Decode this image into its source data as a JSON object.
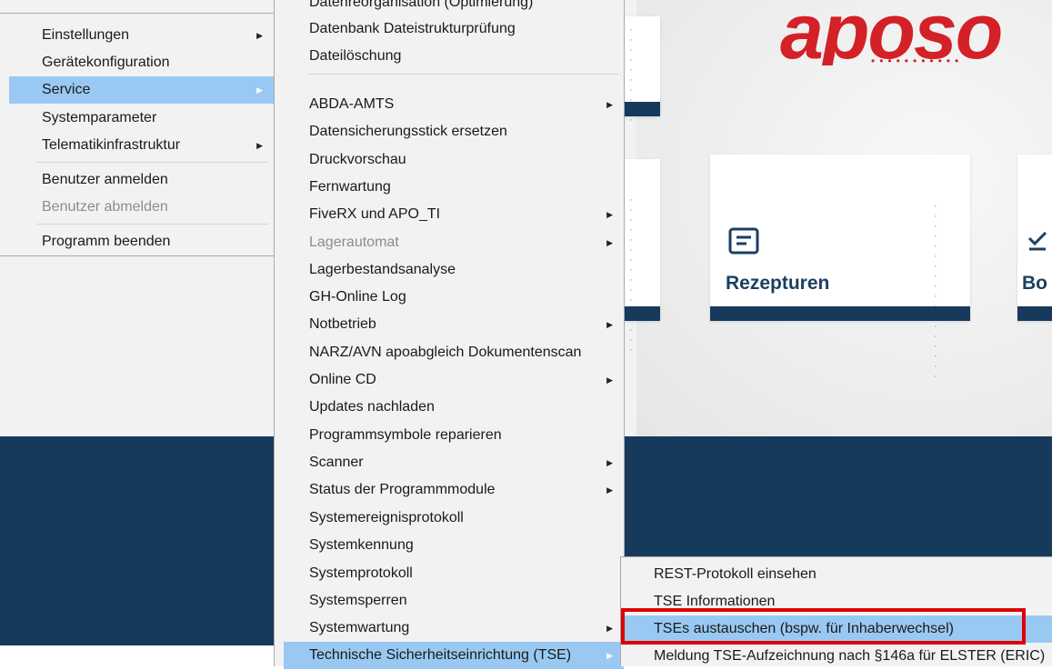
{
  "logo": {
    "text": "aposo",
    "color": "#d42027"
  },
  "tiles": {
    "rezepturen_label": "Rezepturen",
    "rezepturen_icon": "document-icon",
    "partial_right_label": "Bo",
    "partial_right_icon": "checklist-icon"
  },
  "colors": {
    "highlight": "#99c9f2",
    "navy": "#163a5c",
    "annotation": "#e00000"
  },
  "main_menu": {
    "items": [
      {
        "label": "Einstellungen",
        "submenu": true
      },
      {
        "label": "Gerätekonfiguration"
      },
      {
        "label": "Service",
        "submenu": true,
        "highlighted": true
      },
      {
        "label": "Systemparameter"
      },
      {
        "label": "Telematikinfrastruktur",
        "submenu": true
      },
      {
        "label": "Benutzer anmelden"
      },
      {
        "label": "Benutzer abmelden",
        "disabled": true
      },
      {
        "label": "Programm beenden"
      }
    ]
  },
  "service_menu": {
    "items": [
      {
        "label": "Datenreorganisation (Optimierung)"
      },
      {
        "label": "Datenbank Dateistrukturprüfung"
      },
      {
        "label": "Dateilöschung"
      },
      {
        "label": "ABDA-AMTS",
        "submenu": true
      },
      {
        "label": "Datensicherungsstick ersetzen"
      },
      {
        "label": "Druckvorschau"
      },
      {
        "label": "Fernwartung"
      },
      {
        "label": "FiveRX und APO_TI",
        "submenu": true
      },
      {
        "label": "Lagerautomat",
        "submenu": true,
        "disabled": true
      },
      {
        "label": "Lagerbestandsanalyse"
      },
      {
        "label": "GH-Online Log"
      },
      {
        "label": "Notbetrieb",
        "submenu": true
      },
      {
        "label": "NARZ/AVN apoabgleich Dokumentenscan"
      },
      {
        "label": "Online CD",
        "submenu": true
      },
      {
        "label": "Updates nachladen"
      },
      {
        "label": "Programmsymbole reparieren"
      },
      {
        "label": "Scanner",
        "submenu": true
      },
      {
        "label": "Status der Programmmodule",
        "submenu": true
      },
      {
        "label": "Systemereignisprotokoll"
      },
      {
        "label": "Systemkennung"
      },
      {
        "label": "Systemprotokoll"
      },
      {
        "label": "Systemsperren"
      },
      {
        "label": "Systemwartung",
        "submenu": true
      },
      {
        "label": "Technische Sicherheitseinrichtung (TSE)",
        "submenu": true,
        "highlighted": true
      }
    ]
  },
  "tse_menu": {
    "items": [
      {
        "label": "REST-Protokoll einsehen"
      },
      {
        "label": "TSE Informationen"
      },
      {
        "label": "TSEs austauschen (bspw. für Inhaberwechsel)",
        "highlighted": true,
        "annotated": true
      },
      {
        "label": "Meldung TSE-Aufzeichnung nach §146a für ELSTER (ERIC)"
      }
    ]
  }
}
